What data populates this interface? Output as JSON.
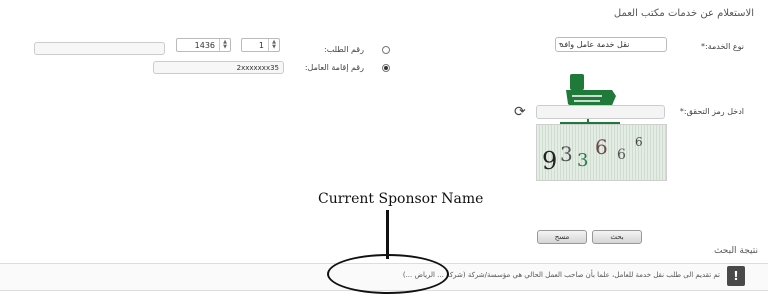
{
  "page": {
    "title": "الاستعلام عن خدمات مكتب العمل"
  },
  "form": {
    "service_type_label": "نوع الخدمة:*",
    "service_type_value": "نقل خدمة عامل وافد",
    "request_number_label": "رقم الطلب:",
    "request_year": "1436",
    "request_seq": "1",
    "iqama_label": "رقم إقامة العامل:",
    "iqama_value": "2xxxxxxx35",
    "captcha_label": "ادخل رمز التحقق:*",
    "captcha_input": "",
    "captcha_chars": [
      "9",
      "3",
      "3",
      "6",
      "6",
      "6"
    ]
  },
  "buttons": {
    "search": "بحث",
    "clear": "مسح"
  },
  "results": {
    "heading": "نتيجة البحث",
    "message": "تم تقديم الى طلب نقل خدمة للعامل، علما بأن صاحب العمل الحالي هي مؤسسة/شركة (شركة ... الرياض ...)",
    "alert_icon": "!"
  },
  "annotation": {
    "label": "Current Sponsor Name"
  },
  "icons": {
    "refresh": "refresh-icon",
    "logo": "saudi-emblem-logo"
  },
  "colors": {
    "brand_green": "#1f7a3a"
  }
}
